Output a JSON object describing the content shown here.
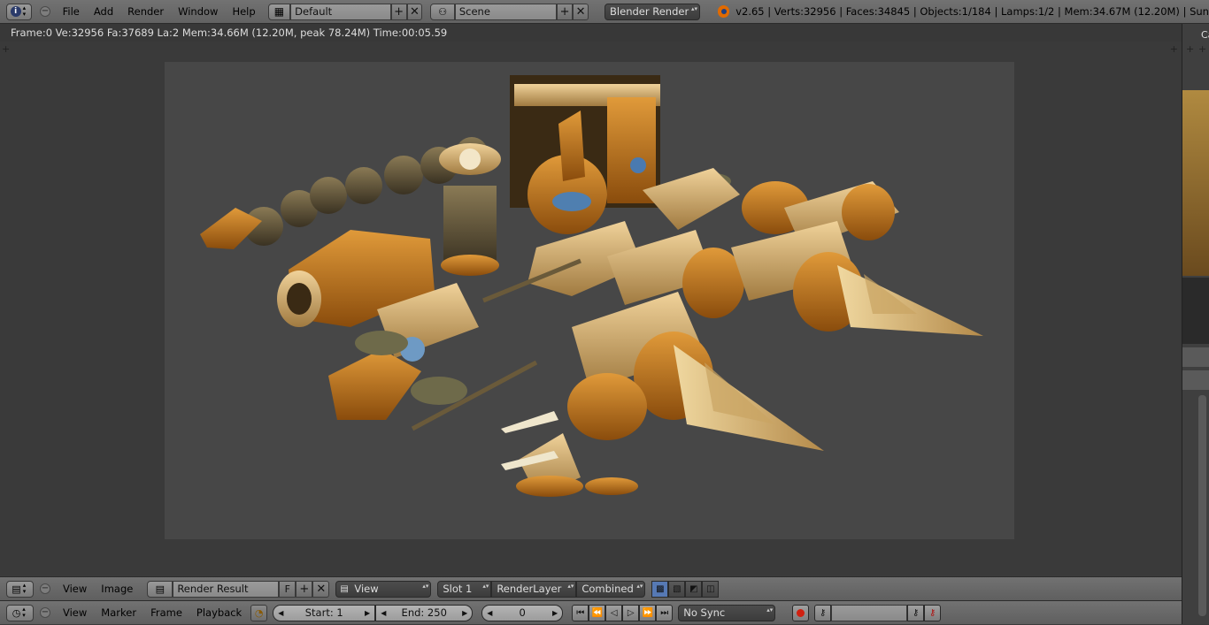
{
  "topbar": {
    "menus": [
      "File",
      "Add",
      "Render",
      "Window",
      "Help"
    ],
    "screen_layout": "Default",
    "scene": "Scene",
    "render_engine": "Blender Render",
    "info": "v2.65 | Verts:32956 | Faces:34845 | Objects:1/184 | Lamps:1/2 | Mem:34.67M (12.20M) | Sun"
  },
  "status": {
    "text": "Frame:0 Ve:32956 Fa:37689 La:2 Mem:34.66M (12.20M, peak 78.24M) Time:00:05.59"
  },
  "image_header": {
    "menus": [
      "View",
      "Image"
    ],
    "image_name": "Render Result",
    "fake_user": "F",
    "view_mode": "View",
    "slot": "Slot 1",
    "layer": "RenderLayer",
    "pass": "Combined"
  },
  "timeline": {
    "menus": [
      "View",
      "Marker",
      "Frame",
      "Playback"
    ],
    "start": "Start: 1",
    "end": "End: 250",
    "current": "0",
    "sync": "No Sync"
  },
  "right_panel": {
    "label": "Ca"
  },
  "colors": {
    "accent": "#e06a00",
    "header_bg": "#6a6a6a",
    "viewport_bg": "#3a3a3a",
    "render_bg": "#474747"
  }
}
